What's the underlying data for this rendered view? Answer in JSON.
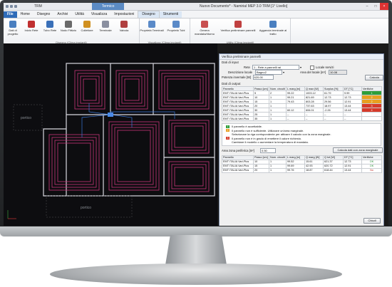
{
  "window": {
    "title": "Nuovo Documento* - Namirial MEP 3.0 TRM [1° Livello]",
    "quick_access": "TRM",
    "context_tab_group": "Termico",
    "controls": [
      "–",
      "□",
      "×"
    ]
  },
  "tabs": [
    {
      "label": "File"
    },
    {
      "label": "Home"
    },
    {
      "label": "Disegno"
    },
    {
      "label": "Archivi"
    },
    {
      "label": "Utilità"
    },
    {
      "label": "Visualizza"
    },
    {
      "label": "Impostazioni"
    },
    {
      "label": "Disegno"
    },
    {
      "label": "Strumenti"
    }
  ],
  "ribbon": {
    "groups": [
      {
        "label": "Disegno (Clima impianti)",
        "buttons": [
          "Dati di progetto",
          "Inizio Rete",
          "Tubo Rete",
          "Nodo Fittizio",
          "Collettore",
          "Terminale",
          "Valvola"
        ]
      },
      {
        "label": "Visualizza (Clima impianti)",
        "buttons": [
          "Proprietà Terminali",
          "Proprietà Tubi"
        ]
      },
      {
        "label": "Utility (Clima impianti)",
        "buttons": [
          "Genera mandata/ritorno",
          "Verifica preliminare pannelli",
          "Aggancia terminale al tratto"
        ]
      }
    ]
  },
  "canvas": {
    "label_left": "portico",
    "label_bottom": "portico"
  },
  "dialog": {
    "title": "Verifica preliminare pannelli",
    "input_section": "Dati di input",
    "rete_label": "Rete",
    "rete_value": "1 - Rete a pannelli rai",
    "locale_servizi_label": "Locale servizi",
    "descrizione_label": "Descrizione locale",
    "descrizione_value": "Bagno2",
    "area_label": "Area del locale [m²]",
    "area_value": "10.08",
    "potenza_label": "Potenza invernale [W]",
    "potenza_value": "620.00",
    "calcola_label": "Calcola",
    "output_section": "Dati di output",
    "out_headers": [
      "Pannello",
      "Passo [cm]",
      "Num. circuiti",
      "L marg [m]",
      "Q max [W]",
      "Surplus [%]",
      "DT [°C]",
      "Verifiche"
    ],
    "out_rows": [
      {
        "cells": [
          "EMT ITALIA Vari-Plus",
          "5",
          "2",
          "99.22",
          "1003.12",
          "61.79",
          "9.99"
        ],
        "status": "1",
        "color": "#2e9e3a"
      },
      {
        "cells": [
          "EMT ITALIA Vari-Plus",
          "10",
          "1",
          "99.21",
          "821.69",
          "12.73",
          "12.73"
        ],
        "status": "2",
        "color": "#e8a020"
      },
      {
        "cells": [
          "EMT ITALIA Vari-Plus",
          "15",
          "1",
          "79.43",
          "803.28",
          "29.56",
          "12.91"
        ],
        "status": "2",
        "color": "#e8a020"
      },
      {
        "cells": [
          "EMT ITALIA Vari-Plus",
          "20",
          "1",
          "",
          "737.63",
          "18.97",
          "13.44"
        ],
        "status": "3",
        "color": "#d63a2a"
      },
      {
        "cells": [
          "EMT ITALIA Vari-Plus",
          "30",
          "1",
          "60.12",
          "606.01",
          "-2.26",
          "13.44"
        ],
        "status": "4",
        "color": "#d63a2a"
      },
      {
        "cells": [
          "EMT ITALIA Vari-Plus",
          "25",
          "1",
          "--",
          "--",
          "--",
          "--"
        ],
        "status": "",
        "color": ""
      },
      {
        "cells": [
          "EMT ITALIA Vari-Plus",
          "35",
          "1",
          "--",
          "--",
          "--",
          "--"
        ],
        "status": "",
        "color": ""
      }
    ],
    "legend": [
      {
        "num": "1",
        "color": "#2e9e3a",
        "text": "Il pannello è accettabile."
      },
      {
        "num": "2",
        "color": "#e8a020",
        "text": "Il pannello non è sufficiente. Utilizzare un'area marginale."
      },
      {
        "num": "",
        "color": "",
        "text": "Selezionare la riga corrispondente per attivare il calcolo con la zona marginale."
      },
      {
        "num": "3",
        "color": "#d63a2a",
        "text": "Il pannello non è in grado di emettere il calore richiesto."
      },
      {
        "num": "",
        "color": "",
        "text": "Cambiare il modello o aumentare la temperatura di mandata."
      }
    ],
    "area_perif_label": "Area zona periferica [m²]",
    "area_perif_value": "0.50",
    "calcola_marg_label": "Calcola dati con zona marginale",
    "marg_headers": [
      "Pannello",
      "Passo [cm]",
      "Num. circuiti",
      "L marg [m]",
      "Q marg [W]",
      "Q tot [W]",
      "DT [°C]",
      "Verifiche"
    ],
    "marg_rows": [
      {
        "cells": [
          "EMT ITALIA Vari-Plus",
          "10",
          "1",
          "99.52",
          "15.61",
          "621.37",
          "12.73"
        ],
        "status": "OK"
      },
      {
        "cells": [
          "EMT ITALIA Vari-Plus",
          "15",
          "1",
          "99.69",
          "42.93",
          "620.72",
          "12.91"
        ],
        "status": "OK"
      },
      {
        "cells": [
          "EMT ITALIA Vari-Plus",
          "20",
          "1",
          "99.76",
          "18.87",
          "618.44",
          "13.44"
        ],
        "status": "No"
      }
    ],
    "close_label": "Chiudi"
  },
  "colors": {
    "accent": "#2e6bb8",
    "context": "#5b8bc4"
  }
}
